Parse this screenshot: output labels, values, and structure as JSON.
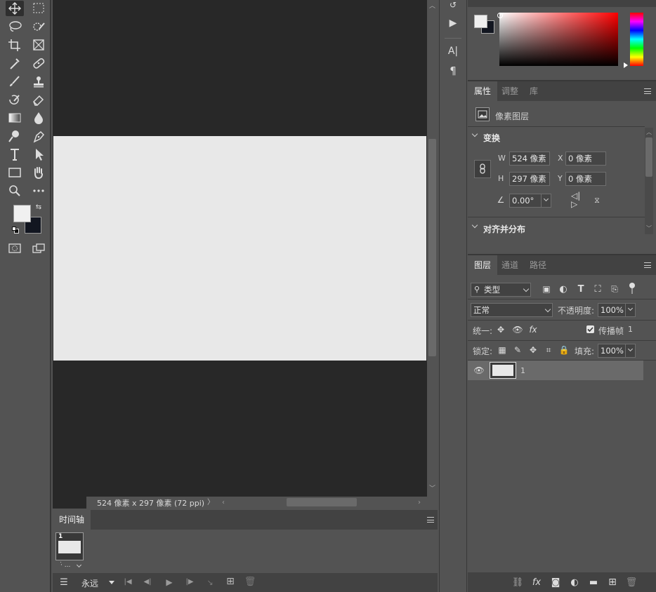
{
  "toolbar": {
    "tools": [
      {
        "name": "move-tool",
        "icon": "✥"
      },
      {
        "name": "marquee-tool",
        "icon": "⬚"
      },
      {
        "name": "lasso-tool",
        "icon": "ʘ"
      },
      {
        "name": "quick-select-tool",
        "icon": "✎"
      },
      {
        "name": "crop-tool",
        "icon": "⌗"
      },
      {
        "name": "frame-tool",
        "icon": "⊠"
      },
      {
        "name": "eyedropper-tool",
        "icon": "⁄"
      },
      {
        "name": "healing-brush-tool",
        "icon": "✚"
      },
      {
        "name": "brush-tool",
        "icon": "⁄"
      },
      {
        "name": "stamp-tool",
        "icon": "♟"
      },
      {
        "name": "history-brush-tool",
        "icon": "↺"
      },
      {
        "name": "eraser-tool",
        "icon": "◇"
      },
      {
        "name": "gradient-tool",
        "icon": "▭"
      },
      {
        "name": "blur-tool",
        "icon": "💧"
      },
      {
        "name": "dodge-tool",
        "icon": "⚲"
      },
      {
        "name": "pen-tool",
        "icon": "✒"
      },
      {
        "name": "type-tool",
        "icon": "T"
      },
      {
        "name": "path-select-tool",
        "icon": "➤"
      },
      {
        "name": "rectangle-tool",
        "icon": "▭"
      },
      {
        "name": "hand-tool",
        "icon": "✋"
      },
      {
        "name": "zoom-tool",
        "icon": "⚲"
      },
      {
        "name": "more-tools",
        "icon": "•••"
      }
    ],
    "fg_color": "#f0f0f0",
    "bg_color": "#121620"
  },
  "document": {
    "status_text": "524 像素 x 297 像素 (72 ppi)",
    "canvas_color": "#e8e8e8"
  },
  "timeline": {
    "tab_label": "时间轴",
    "frame_number": "1",
    "frame_delay": "·̇ ...",
    "loop_label": "永远"
  },
  "mid_dock": {
    "char_icon": "A|",
    "para_icon": "¶"
  },
  "properties": {
    "tabs": [
      "属性",
      "调整",
      "库"
    ],
    "layer_type": "像素图层",
    "transform_title": "变换",
    "w_label": "W",
    "w_value": "524 像素",
    "x_label": "X",
    "x_value": "0 像素",
    "h_label": "H",
    "h_value": "297 像素",
    "y_label": "Y",
    "y_value": "0 像素",
    "angle_value": "0.00°",
    "align_title": "对齐并分布"
  },
  "layers": {
    "tabs": [
      "图层",
      "通道",
      "路径"
    ],
    "filter_label": "类型",
    "blend_mode": "正常",
    "opacity_label": "不透明度:",
    "opacity_value": "100%",
    "unify_label": "统一:",
    "propagate_label": "传播帧",
    "propagate_value": "1",
    "lock_label": "锁定:",
    "fill_label": "填充:",
    "fill_value": "100%",
    "layer_name": "1"
  }
}
